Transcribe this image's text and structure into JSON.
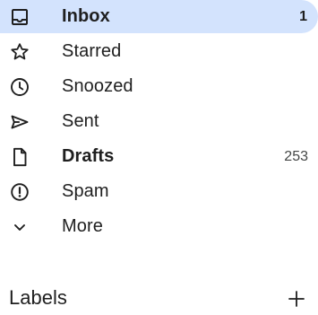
{
  "nav": {
    "items": [
      {
        "id": "inbox",
        "label": "Inbox",
        "count": "1",
        "icon": "inbox-icon",
        "active": true
      },
      {
        "id": "starred",
        "label": "Starred",
        "count": "",
        "icon": "star-icon"
      },
      {
        "id": "snoozed",
        "label": "Snoozed",
        "count": "",
        "icon": "clock-icon"
      },
      {
        "id": "sent",
        "label": "Sent",
        "count": "",
        "icon": "send-icon"
      },
      {
        "id": "drafts",
        "label": "Drafts",
        "count": "253",
        "icon": "draft-file-icon",
        "bold": true
      },
      {
        "id": "spam",
        "label": "Spam",
        "count": "",
        "icon": "report-spam-icon"
      },
      {
        "id": "more",
        "label": "More",
        "count": "",
        "icon": "chevron-down-icon"
      }
    ]
  },
  "labels": {
    "title": "Labels",
    "add_icon": "plus-icon"
  },
  "colors": {
    "active_background": "#d3e3fd",
    "text": "#1f1f1f",
    "icon": "#1f1f1f"
  }
}
